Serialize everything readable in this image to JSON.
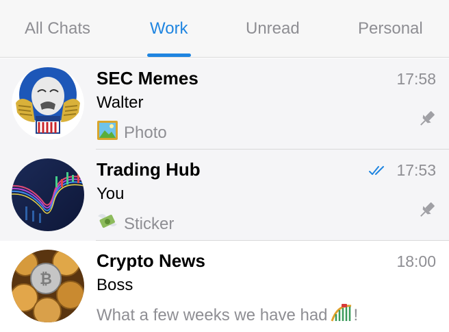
{
  "tabs": {
    "all": "All Chats",
    "work": "Work",
    "unread": "Unread",
    "personal": "Personal",
    "active": "Work"
  },
  "chats": [
    {
      "title": "SEC Memes",
      "time": "17:58",
      "sender": "Walter",
      "preview": "Photo",
      "preview_icon": "photo-icon",
      "pinned": true
    },
    {
      "title": "Trading Hub",
      "time": "17:53",
      "sender": "You",
      "preview": "Sticker",
      "preview_icon": "money-wings-icon",
      "read_status": "double-check-icon",
      "pinned": true
    },
    {
      "title": "Crypto News",
      "time": "18:00",
      "sender": "Boss",
      "preview": "What a few weeks we have had",
      "preview_suffix": "!",
      "preview_icon": "roller-coaster-icon",
      "pinned": false
    }
  ],
  "colors": {
    "accent": "#1f85e0",
    "secondary_text": "#8e8e93",
    "pinned_background": "#f5f5f7"
  }
}
